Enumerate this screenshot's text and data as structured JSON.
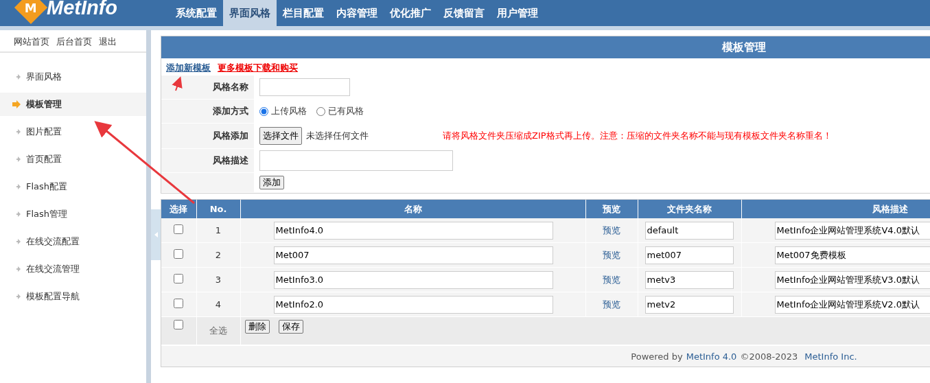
{
  "logo": {
    "badge": "M",
    "text": "MetInfo"
  },
  "nav": [
    {
      "label": "系统配置",
      "selected": false
    },
    {
      "label": "界面风格",
      "selected": true
    },
    {
      "label": "栏目配置",
      "selected": false
    },
    {
      "label": "内容管理",
      "selected": false
    },
    {
      "label": "优化推广",
      "selected": false
    },
    {
      "label": "反馈留言",
      "selected": false
    },
    {
      "label": "用户管理",
      "selected": false
    }
  ],
  "top_links": [
    "网站首页",
    "后台首页",
    "退出"
  ],
  "sidebar": {
    "items": [
      {
        "label": "界面风格",
        "selected": false
      },
      {
        "label": "模板管理",
        "selected": true
      },
      {
        "label": "图片配置",
        "selected": false
      },
      {
        "label": "首页配置",
        "selected": false
      },
      {
        "label": "Flash配置",
        "selected": false
      },
      {
        "label": "Flash管理",
        "selected": false
      },
      {
        "label": "在线交流配置",
        "selected": false
      },
      {
        "label": "在线交流管理",
        "selected": false
      },
      {
        "label": "模板配置导航",
        "selected": false
      }
    ]
  },
  "panel": {
    "title": "模板管理",
    "links": [
      {
        "label": "添加新模板",
        "kind": "normal"
      },
      {
        "label": "更多模板下载和购买",
        "kind": "highlight"
      }
    ]
  },
  "form": {
    "name_label": "风格名称",
    "method_label": "添加方式",
    "methods": [
      {
        "label": "上传风格",
        "selected": true
      },
      {
        "label": "已有风格",
        "selected": false
      }
    ],
    "file_label": "风格添加",
    "file_button": "选择文件",
    "file_status": "未选择任何文件",
    "file_note": "请将风格文件夹压缩成ZIP格式再上传。注意：压缩的文件夹名称不能与现有模板文件夹名称重名！",
    "desc_label": "风格描述",
    "submit": "添加"
  },
  "table": {
    "columns": [
      "选择",
      "No.",
      "名称",
      "预览",
      "文件夹名称",
      "风格描述"
    ],
    "rows": [
      {
        "checked": false,
        "no": "1",
        "name": "MetInfo4.0",
        "preview": "预览",
        "folder": "default",
        "description": "MetInfo企业网站管理系统V4.0默认"
      },
      {
        "checked": false,
        "no": "2",
        "name": "Met007",
        "preview": "预览",
        "folder": "met007",
        "description": "Met007免费模板"
      },
      {
        "checked": false,
        "no": "3",
        "name": "MetInfo3.0",
        "preview": "预览",
        "folder": "metv3",
        "description": "MetInfo企业网站管理系统V3.0默认"
      },
      {
        "checked": false,
        "no": "4",
        "name": "MetInfo2.0",
        "preview": "预览",
        "folder": "metv2",
        "description": "MetInfo企业网站管理系统V2.0默认"
      }
    ],
    "footer": {
      "checked": false,
      "select_all": "全选",
      "buttons": [
        "删除",
        "保存"
      ]
    }
  },
  "credits": {
    "prefix": "Powered by",
    "product": "MetInfo 4.0",
    "years": "©2008-2023",
    "company": "MetInfo Inc."
  }
}
